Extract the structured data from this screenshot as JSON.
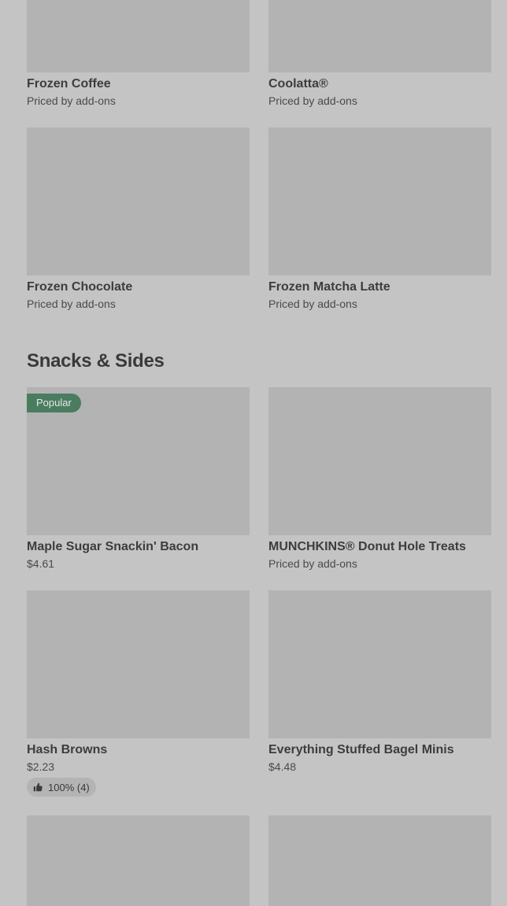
{
  "frozen_drinks": [
    {
      "name": "Frozen Coffee",
      "subtitle": "Priced by add-ons"
    },
    {
      "name": "Coolatta®",
      "subtitle": "Priced by add-ons"
    },
    {
      "name": "Frozen Chocolate",
      "subtitle": "Priced by add-ons"
    },
    {
      "name": "Frozen Matcha Latte",
      "subtitle": "Priced by add-ons"
    }
  ],
  "snacks_section": {
    "title": "Snacks & Sides",
    "popular_badge": "Popular",
    "items": [
      {
        "name": "Maple Sugar Snackin' Bacon",
        "price": "$4.61"
      },
      {
        "name": "MUNCHKINS® Donut Hole Treats",
        "price": "Priced by add-ons"
      },
      {
        "name": "Hash Browns",
        "price": "$2.23",
        "rating": "100% (4)"
      },
      {
        "name": "Everything Stuffed Bagel Minis",
        "price": "$4.48"
      }
    ]
  },
  "colors": {
    "background": "#c4c4c4",
    "image_placeholder": "#b3b3b3",
    "badge": "#4a7d60"
  }
}
